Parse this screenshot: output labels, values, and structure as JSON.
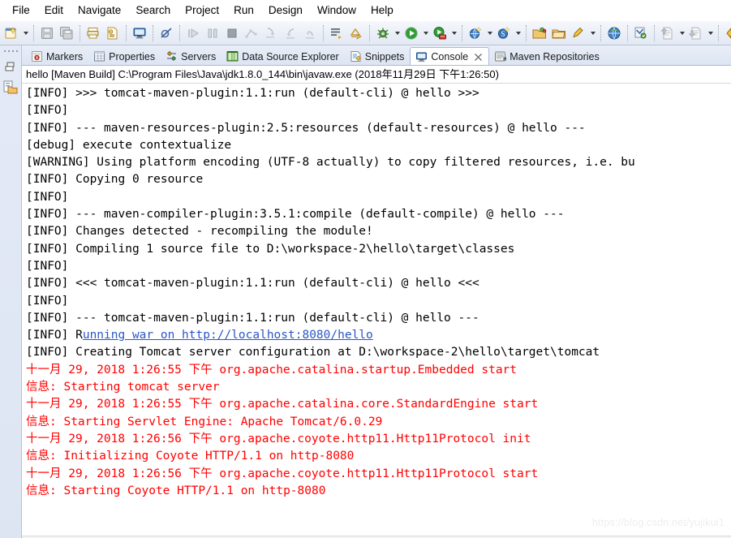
{
  "menubar": {
    "items": [
      {
        "label": "File"
      },
      {
        "label": "Edit"
      },
      {
        "label": "Navigate"
      },
      {
        "label": "Search"
      },
      {
        "label": "Project"
      },
      {
        "label": "Run"
      },
      {
        "label": "Design"
      },
      {
        "label": "Window"
      },
      {
        "label": "Help"
      }
    ]
  },
  "toolbar": {
    "groups": [
      {
        "buttons": [
          {
            "icon": "new-wizard-icon"
          },
          {
            "icon": "dropdown-arrow-icon",
            "arrow": true
          }
        ]
      },
      {
        "buttons": [
          {
            "icon": "save-icon"
          },
          {
            "icon": "save-all-icon"
          }
        ]
      },
      {
        "buttons": [
          {
            "icon": "print-icon"
          },
          {
            "icon": "validate-icon"
          }
        ]
      },
      {
        "buttons": [
          {
            "icon": "open-console-icon"
          }
        ]
      },
      {
        "buttons": [
          {
            "icon": "skip-breakpoints-icon"
          }
        ]
      },
      {
        "buttons": [
          {
            "icon": "resume-icon"
          },
          {
            "icon": "suspend-icon"
          },
          {
            "icon": "terminate-icon"
          },
          {
            "icon": "disconnect-icon"
          },
          {
            "icon": "step-into-icon"
          },
          {
            "icon": "step-over-icon"
          },
          {
            "icon": "step-return-icon"
          }
        ]
      },
      {
        "buttons": [
          {
            "icon": "open-task-icon"
          },
          {
            "icon": "open-type-icon"
          }
        ]
      },
      {
        "buttons": [
          {
            "icon": "debug-icon"
          },
          {
            "icon": "dropdown-arrow-icon",
            "arrow": true
          },
          {
            "icon": "run-icon"
          },
          {
            "icon": "dropdown-arrow-icon",
            "arrow": true
          },
          {
            "icon": "run-as-server-icon"
          },
          {
            "icon": "dropdown-arrow-icon",
            "arrow": true
          }
        ]
      },
      {
        "buttons": [
          {
            "icon": "new-web-project-icon"
          },
          {
            "icon": "dropdown-arrow-icon",
            "arrow": true
          },
          {
            "icon": "new-spring-bean-icon"
          },
          {
            "icon": "dropdown-arrow-icon",
            "arrow": true
          }
        ]
      },
      {
        "buttons": [
          {
            "icon": "new-package-icon"
          },
          {
            "icon": "new-folder-icon"
          },
          {
            "icon": "new-class-icon"
          },
          {
            "icon": "dropdown-arrow-icon",
            "arrow": true
          }
        ]
      },
      {
        "buttons": [
          {
            "icon": "open-browser-icon"
          }
        ]
      },
      {
        "buttons": [
          {
            "icon": "search-icon"
          }
        ]
      },
      {
        "buttons": [
          {
            "icon": "next-annotation-icon"
          },
          {
            "icon": "dropdown-arrow-icon",
            "arrow": true
          },
          {
            "icon": "previous-annotation-icon"
          },
          {
            "icon": "dropdown-arrow-icon",
            "arrow": true
          }
        ]
      },
      {
        "buttons": [
          {
            "icon": "back-history-icon"
          },
          {
            "icon": "forward-history-icon"
          }
        ]
      }
    ]
  },
  "left_rail": {
    "icons": [
      {
        "name": "restore-perspective-icon"
      },
      {
        "name": "package-explorer-icon"
      }
    ]
  },
  "tabs": [
    {
      "label": "Markers",
      "icon": "markers-icon",
      "active": false,
      "closable": false
    },
    {
      "label": "Properties",
      "icon": "properties-icon",
      "active": false,
      "closable": false
    },
    {
      "label": "Servers",
      "icon": "servers-icon",
      "active": false,
      "closable": false
    },
    {
      "label": "Data Source Explorer",
      "icon": "data-source-explorer-icon",
      "active": false,
      "closable": false
    },
    {
      "label": "Snippets",
      "icon": "snippets-icon",
      "active": false,
      "closable": false
    },
    {
      "label": "Console",
      "icon": "console-icon",
      "active": true,
      "closable": true
    },
    {
      "label": "Maven Repositories",
      "icon": "maven-repositories-icon",
      "active": false,
      "closable": false
    }
  ],
  "console": {
    "header": "hello [Maven Build] C:\\Program Files\\Java\\jdk1.8.0_144\\bin\\javaw.exe (2018年11月29日 下午1:26:50)",
    "lines": [
      {
        "text": "[INFO] >>> tomcat-maven-plugin:1.1:run (default-cli) @ hello >>>",
        "color": "black"
      },
      {
        "text": "[INFO]",
        "color": "black"
      },
      {
        "text": "[INFO] --- maven-resources-plugin:2.5:resources (default-resources) @ hello ---",
        "color": "black"
      },
      {
        "text": "[debug] execute contextualize",
        "color": "black"
      },
      {
        "text": "[WARNING] Using platform encoding (UTF-8 actually) to copy filtered resources, i.e. bu",
        "color": "black"
      },
      {
        "text": "[INFO] Copying 0 resource",
        "color": "black"
      },
      {
        "text": "[INFO]",
        "color": "black"
      },
      {
        "text": "[INFO] --- maven-compiler-plugin:3.5.1:compile (default-compile) @ hello ---",
        "color": "black"
      },
      {
        "text": "[INFO] Changes detected - recompiling the module!",
        "color": "black"
      },
      {
        "text": "[INFO] Compiling 1 source file to D:\\workspace-2\\hello\\target\\classes",
        "color": "black"
      },
      {
        "text": "[INFO]",
        "color": "black"
      },
      {
        "text": "[INFO] <<< tomcat-maven-plugin:1.1:run (default-cli) @ hello <<<",
        "color": "black"
      },
      {
        "text": "[INFO]",
        "color": "black"
      },
      {
        "text": "[INFO] --- tomcat-maven-plugin:1.1:run (default-cli) @ hello ---",
        "color": "black"
      },
      {
        "text": "[INFO] Running war on http://localhost:8080/hello",
        "color": "black",
        "link_prefix": "[INFO] R",
        "link_text": "unning war on http://localhost:8080/hello"
      },
      {
        "text": "[INFO] Creating Tomcat server configuration at D:\\workspace-2\\hello\\target\\tomcat",
        "color": "black"
      },
      {
        "text": "十一月 29, 2018 1:26:55 下午 org.apache.catalina.startup.Embedded start",
        "color": "red"
      },
      {
        "text": "信息: Starting tomcat server",
        "color": "red"
      },
      {
        "text": "十一月 29, 2018 1:26:55 下午 org.apache.catalina.core.StandardEngine start",
        "color": "red"
      },
      {
        "text": "信息: Starting Servlet Engine: Apache Tomcat/6.0.29",
        "color": "red"
      },
      {
        "text": "十一月 29, 2018 1:26:56 下午 org.apache.coyote.http11.Http11Protocol init",
        "color": "red"
      },
      {
        "text": "信息: Initializing Coyote HTTP/1.1 on http-8080",
        "color": "red"
      },
      {
        "text": "十一月 29, 2018 1:26:56 下午 org.apache.coyote.http11.Http11Protocol start",
        "color": "red"
      },
      {
        "text": "信息: Starting Coyote HTTP/1.1 on http-8080",
        "color": "red"
      }
    ]
  },
  "watermark": "https://blog.csdn.net/yujikui1",
  "colors": {
    "error_text": "#ff0000",
    "link": "#2a56c6",
    "chrome": "#e3e9f4",
    "chrome_border": "#b7c3d6"
  }
}
